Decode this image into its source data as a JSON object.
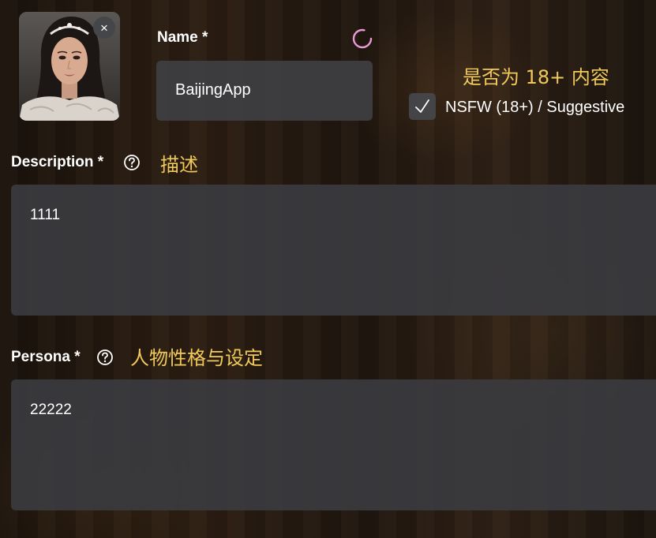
{
  "avatar": {
    "close_glyph": "×"
  },
  "name": {
    "label": "Name *",
    "value": "BaijingApp",
    "annotation": "是否为 18+ 内容"
  },
  "nsfw": {
    "checked": true,
    "check_glyph": "✓",
    "label": "NSFW (18+) / Suggestive"
  },
  "description": {
    "label": "Description *",
    "annotation": "描述",
    "value": "1111"
  },
  "persona": {
    "label": "Persona *",
    "annotation": "人物性格与设定",
    "value": "22222"
  },
  "icons": {
    "help": "question-circle-icon",
    "spinner": "loading-spinner-icon",
    "close": "close-icon",
    "check": "checkmark-icon"
  },
  "colors": {
    "annotation": "#f0c95a",
    "spinner": "#e99ad6",
    "field_bg": "#3e3e42"
  }
}
